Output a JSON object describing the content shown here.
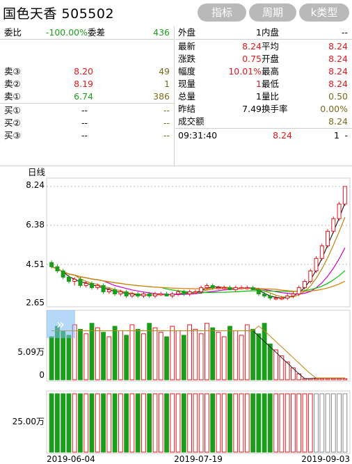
{
  "header": {
    "title": "国色天香 505502",
    "buttons": [
      "指标",
      "周期",
      "k类型"
    ]
  },
  "order_book": {
    "webi_label": "委比",
    "webi_value": "-100.00%",
    "wecha_label": "委差",
    "wecha_value": "436",
    "asks": [
      {
        "label": "卖③",
        "price": "8.20",
        "vol": "49"
      },
      {
        "label": "卖②",
        "price": "8.19",
        "vol": "1"
      },
      {
        "label": "卖①",
        "price": "6.74",
        "vol": "386"
      }
    ],
    "bids": [
      {
        "label": "买①",
        "price": "--",
        "vol": "--"
      },
      {
        "label": "买②",
        "price": "--",
        "vol": "--"
      },
      {
        "label": "买③",
        "price": "--",
        "vol": "--"
      }
    ]
  },
  "stats": [
    {
      "l1": "外盘",
      "v1": "1",
      "l2": "内盘",
      "v2": "--"
    },
    {
      "l1": "最新",
      "v1": "8.24",
      "l2": "平均",
      "v2": "8.24"
    },
    {
      "l1": "涨跌",
      "v1": "0.75",
      "l2": "开盘",
      "v2": "8.24"
    },
    {
      "l1": "幅度",
      "v1": "10.01%",
      "l2": "最高",
      "v2": "8.24"
    },
    {
      "l1": "现量",
      "v1": "1",
      "l2": "最低",
      "v2": "8.24"
    },
    {
      "l1": "总量",
      "v1": "1",
      "l2": "量比",
      "v2": "0.50"
    },
    {
      "l1": "昨结",
      "v1": "7.49",
      "l2": "换手率",
      "v2": "0.00%"
    },
    {
      "l1": "成交额",
      "v1": "",
      "l2": "",
      "v2": "8.24"
    }
  ],
  "tick": {
    "time": "09:31:40",
    "price": "8.24",
    "vol": "1",
    "dir": "-"
  },
  "chart": {
    "period_label": "日线",
    "price_ticks": [
      "8.24",
      "6.38",
      "4.51",
      "2.65"
    ],
    "vol_tick": "5.09万",
    "vol_zero": "0",
    "ind_tick": "25.00万",
    "dates": [
      "2019-06-04",
      "2019-07-19",
      "2019-09-03"
    ],
    "up_color": "#e8161b",
    "down_color": "#1b9e1b",
    "ma_colors": [
      "#222222",
      "#b8860b",
      "#cc00cc",
      "#00c000",
      "#e07a00"
    ]
  },
  "chart_data": {
    "type": "candlestick",
    "xlabel": "",
    "ylabel": "",
    "price_range": [
      2.65,
      8.24
    ],
    "x_ticks": [
      "2019-06-04",
      "2019-07-19",
      "2019-09-03"
    ],
    "candles_ohlc": [
      [
        4.6,
        4.7,
        4.3,
        4.4
      ],
      [
        4.4,
        4.5,
        4.1,
        4.2
      ],
      [
        4.2,
        4.3,
        3.8,
        3.9
      ],
      [
        3.9,
        4.0,
        3.6,
        3.7
      ],
      [
        3.7,
        3.9,
        3.5,
        3.8
      ],
      [
        3.8,
        3.9,
        3.4,
        3.5
      ],
      [
        3.5,
        3.7,
        3.4,
        3.6
      ],
      [
        3.6,
        3.7,
        3.3,
        3.4
      ],
      [
        3.4,
        3.6,
        3.3,
        3.5
      ],
      [
        3.5,
        3.6,
        3.1,
        3.2
      ],
      [
        3.2,
        3.4,
        3.1,
        3.3
      ],
      [
        3.3,
        3.4,
        3.0,
        3.1
      ],
      [
        3.1,
        3.3,
        3.0,
        3.2
      ],
      [
        3.2,
        3.3,
        2.9,
        3.0
      ],
      [
        3.0,
        3.2,
        2.9,
        3.1
      ],
      [
        3.1,
        3.2,
        2.9,
        3.0
      ],
      [
        3.0,
        3.2,
        2.9,
        3.1
      ],
      [
        3.1,
        3.2,
        2.9,
        3.0
      ],
      [
        3.0,
        3.2,
        2.9,
        3.1
      ],
      [
        3.1,
        3.2,
        3.0,
        3.1
      ],
      [
        3.1,
        3.2,
        3.0,
        3.0
      ],
      [
        3.0,
        3.2,
        2.9,
        3.1
      ],
      [
        3.1,
        3.3,
        3.0,
        3.2
      ],
      [
        3.2,
        3.3,
        3.0,
        3.1
      ],
      [
        3.1,
        3.3,
        3.0,
        3.2
      ],
      [
        3.2,
        3.3,
        3.1,
        3.2
      ],
      [
        3.2,
        3.5,
        3.1,
        3.4
      ],
      [
        3.4,
        3.6,
        3.3,
        3.5
      ],
      [
        3.5,
        3.6,
        3.3,
        3.4
      ],
      [
        3.4,
        3.5,
        3.3,
        3.4
      ],
      [
        3.4,
        3.5,
        3.3,
        3.4
      ],
      [
        3.4,
        3.5,
        3.3,
        3.3
      ],
      [
        3.3,
        3.5,
        3.2,
        3.4
      ],
      [
        3.4,
        3.5,
        3.3,
        3.4
      ],
      [
        3.4,
        3.5,
        3.3,
        3.4
      ],
      [
        3.4,
        3.5,
        3.3,
        3.3
      ],
      [
        3.3,
        3.4,
        3.0,
        3.1
      ],
      [
        3.1,
        3.2,
        2.9,
        3.0
      ],
      [
        3.0,
        3.1,
        2.8,
        2.9
      ],
      [
        2.9,
        3.0,
        2.8,
        2.9
      ],
      [
        2.9,
        3.0,
        2.8,
        2.9
      ],
      [
        2.9,
        3.1,
        2.8,
        3.0
      ],
      [
        3.0,
        3.2,
        2.9,
        3.1
      ],
      [
        3.1,
        3.5,
        3.0,
        3.4
      ],
      [
        3.4,
        3.8,
        3.3,
        3.7
      ],
      [
        3.7,
        4.3,
        3.6,
        4.2
      ],
      [
        4.2,
        4.9,
        4.1,
        4.8
      ],
      [
        4.8,
        5.5,
        4.7,
        5.4
      ],
      [
        5.4,
        6.2,
        5.3,
        6.1
      ],
      [
        6.1,
        6.8,
        6.0,
        6.7
      ],
      [
        6.7,
        7.5,
        6.6,
        7.4
      ],
      [
        7.4,
        8.24,
        7.3,
        8.24
      ]
    ]
  }
}
